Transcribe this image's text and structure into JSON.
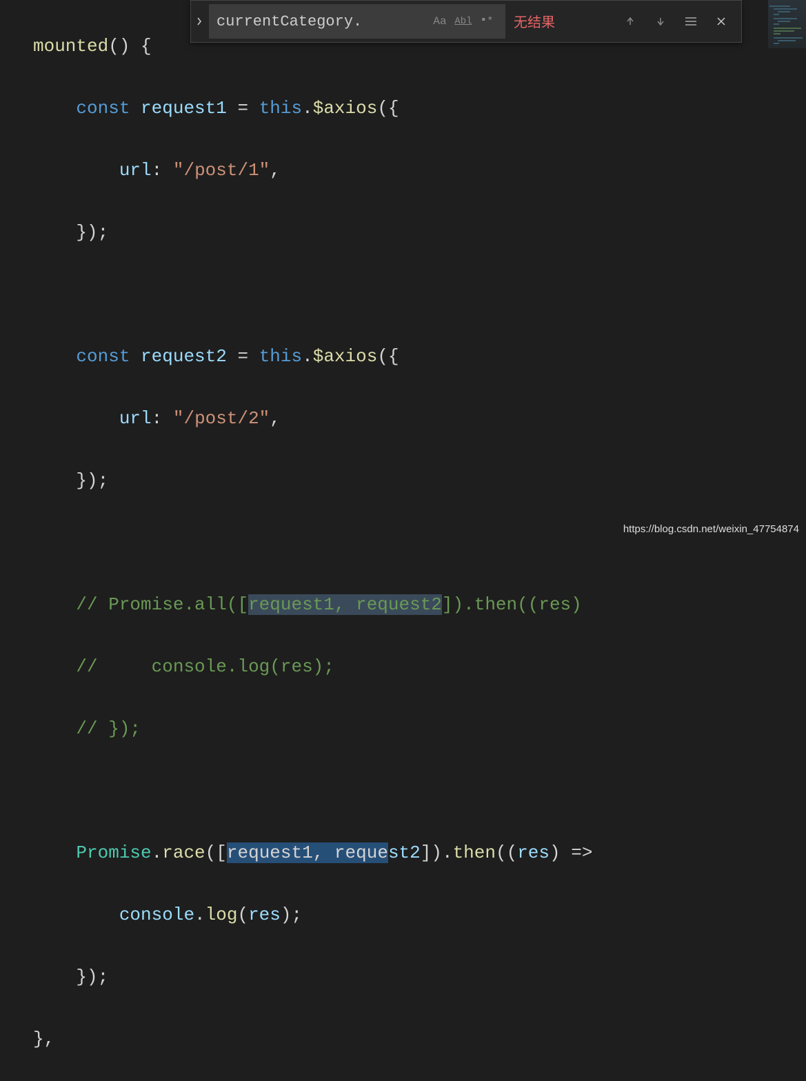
{
  "find": {
    "input_value": "currentCategory.",
    "case_label": "Aa",
    "word_label": "Abl",
    "regex_label": ".*",
    "result_text": "无结果"
  },
  "code": {
    "l1": {
      "func": "mounted",
      "rest": "() {"
    },
    "l2": {
      "kw": "const",
      "var": "request1",
      "eq": " = ",
      "this": "this",
      "dot": ".",
      "call": "$axios",
      "rest": "({"
    },
    "l3": {
      "prop": "url",
      "colon": ": ",
      "str": "\"/post/1\"",
      "comma": ","
    },
    "l4": {
      "close": "});"
    },
    "l5": {
      "blank": ""
    },
    "l6": {
      "kw": "const",
      "var": "request2",
      "eq": " = ",
      "this": "this",
      "dot": ".",
      "call": "$axios",
      "rest": "({"
    },
    "l7": {
      "prop": "url",
      "colon": ": ",
      "str": "\"/post/2\"",
      "comma": ","
    },
    "l8": {
      "close": "});"
    },
    "l9": {
      "blank": ""
    },
    "l10": {
      "pre": "// Promise.all([",
      "hl": "request1, request2",
      "post": "]).then((res)"
    },
    "l11": {
      "text": "//     console.log(res);"
    },
    "l12": {
      "text": "// });"
    },
    "l13": {
      "blank": ""
    },
    "l14": {
      "type": "Promise",
      "dot": ".",
      "call": "race",
      "open": "([",
      "sel": "request1, reque",
      "postsel": "st2",
      "close": "]).",
      "call2": "then",
      "args": "((",
      "param": "res",
      "paren": ") =>"
    },
    "l15": {
      "obj": "console",
      "dot": ".",
      "call": "log",
      "open": "(",
      "param": "res",
      "close": ");"
    },
    "l16": {
      "close": "});"
    },
    "l17": {
      "close": "},"
    }
  },
  "watermark": "https://blog.csdn.net/weixin_47754874"
}
